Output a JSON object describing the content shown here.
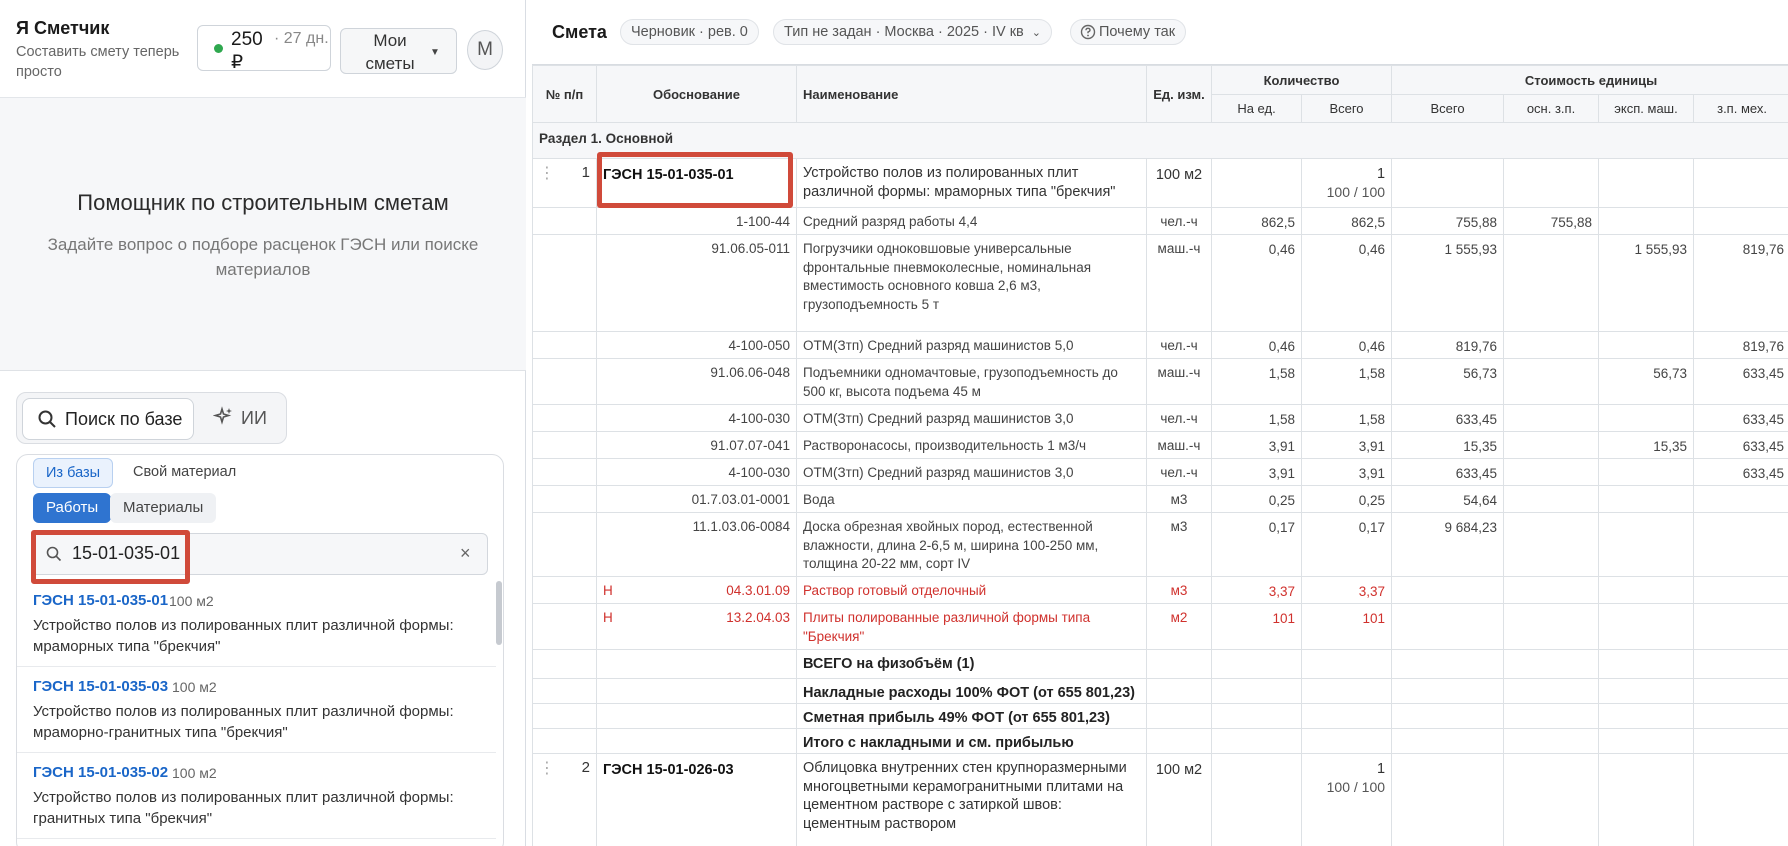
{
  "app": {
    "title": "Я Сметчик",
    "tagline": "Составить смету теперь просто",
    "balance_amount": "250 ₽",
    "balance_days": "· 27 дн.",
    "my_smety": "Мои сметы",
    "avatar": "М"
  },
  "helper": {
    "title": "Помощник по строительным сметам",
    "subtitle": "Задайте вопрос о подборе расценок ГЭСН или поиске материалов"
  },
  "modes": {
    "search": "Поиск по базе",
    "ai": "ИИ"
  },
  "results_panel": {
    "source_tabs": [
      "Из базы",
      "Свой материал"
    ],
    "kind_tabs": [
      "Работы",
      "Материалы"
    ],
    "search_value": "15-01-035-01",
    "clear": "×",
    "items": [
      {
        "code": "ГЭСН 15-01-035-01",
        "unit": "100 м2",
        "desc": "Устройство полов из полированных плит различной формы: мраморных типа \"брекчия\""
      },
      {
        "code": "ГЭСН 15-01-035-03",
        "unit": "100 м2",
        "desc": "Устройство полов из полированных плит различной формы: мраморно-гранитных типа \"брекчия\""
      },
      {
        "code": "ГЭСН 15-01-035-02",
        "unit": "100 м2",
        "desc": "Устройство полов из полированных плит различной формы: гранитных типа \"брекчия\""
      }
    ]
  },
  "estimate": {
    "title": "Смета",
    "status": "Черновик · рев. 0",
    "type": "Тип не задан · Москва · 2025 · IV кв",
    "why": "Почему так",
    "headers": {
      "num": "№ п/п",
      "basis": "Обоснование",
      "name": "Наименование",
      "unit": "Ед. изм.",
      "qty": "Количество",
      "qty_per": "На ед.",
      "qty_total": "Всего",
      "cost": "Стоимость единицы",
      "cost_total": "Всего",
      "cost_osn": "осн. з.п.",
      "cost_exp": "эксп. маш.",
      "cost_zpm": "з.п. мех."
    },
    "section": "Раздел 1. Основной",
    "pos1": {
      "num": "1",
      "code": "ГЭСН 15-01-035-01",
      "name": "Устройство полов из полированных плит различной формы: мраморных типа \"брекчия\"",
      "unit": "100 м2",
      "qty_total": "1",
      "qty_sub": "100 / 100"
    },
    "rows": [
      {
        "mark": "",
        "code": "1-100-44",
        "name": "Средний разряд работы 4,4",
        "unit": "чел.-ч",
        "per": "862,5",
        "tot": "862,5",
        "ctot": "755,88",
        "osn": "755,88",
        "exp": "",
        "zpm": ""
      },
      {
        "mark": "",
        "code": "91.06.05-011",
        "name": "Погрузчики одноковшовые универсальные фронтальные пневмоколесные, номинальная вместимость основного ковша 2,6 м3, грузоподъемность 5 т",
        "unit": "маш.-ч",
        "per": "0,46",
        "tot": "0,46",
        "ctot": "1 555,93",
        "osn": "",
        "exp": "1 555,93",
        "zpm": "819,76"
      },
      {
        "mark": "",
        "code": "4-100-050",
        "name": "ОТМ(Зтп) Средний разряд машинистов 5,0",
        "unit": "чел.-ч",
        "per": "0,46",
        "tot": "0,46",
        "ctot": "819,76",
        "osn": "",
        "exp": "",
        "zpm": "819,76"
      },
      {
        "mark": "",
        "code": "91.06.06-048",
        "name": "Подъемники одномачтовые, грузоподъемность до 500 кг, высота подъема 45 м",
        "unit": "маш.-ч",
        "per": "1,58",
        "tot": "1,58",
        "ctot": "56,73",
        "osn": "",
        "exp": "56,73",
        "zpm": "633,45"
      },
      {
        "mark": "",
        "code": "4-100-030",
        "name": "ОТМ(Зтп) Средний разряд машинистов 3,0",
        "unit": "чел.-ч",
        "per": "1,58",
        "tot": "1,58",
        "ctot": "633,45",
        "osn": "",
        "exp": "",
        "zpm": "633,45"
      },
      {
        "mark": "",
        "code": "91.07.07-041",
        "name": "Растворонасосы, производительность 1 м3/ч",
        "unit": "маш.-ч",
        "per": "3,91",
        "tot": "3,91",
        "ctot": "15,35",
        "osn": "",
        "exp": "15,35",
        "zpm": "633,45"
      },
      {
        "mark": "",
        "code": "4-100-030",
        "name": "ОТМ(Зтп) Средний разряд машинистов 3,0",
        "unit": "чел.-ч",
        "per": "3,91",
        "tot": "3,91",
        "ctot": "633,45",
        "osn": "",
        "exp": "",
        "zpm": "633,45"
      },
      {
        "mark": "",
        "code": "01.7.03.01-0001",
        "name": "Вода",
        "unit": "м3",
        "per": "0,25",
        "tot": "0,25",
        "ctot": "54,64",
        "osn": "",
        "exp": "",
        "zpm": ""
      },
      {
        "mark": "",
        "code": "11.1.03.06-0084",
        "name": "Доска обрезная хвойных пород, естественной влажности, длина 2-6,5 м, ширина 100-250 мм, толщина 20-22 мм, сорт IV",
        "unit": "м3",
        "per": "0,17",
        "tot": "0,17",
        "ctot": "9 684,23",
        "osn": "",
        "exp": "",
        "zpm": ""
      },
      {
        "mark": "Н",
        "code": "04.3.01.09",
        "name": "Раствор готовый отделочный",
        "unit": "м3",
        "per": "3,37",
        "tot": "3,37",
        "ctot": "",
        "osn": "",
        "exp": "",
        "zpm": ""
      },
      {
        "mark": "Н",
        "code": "13.2.04.03",
        "name": "Плиты полированные различной формы типа \"Брекчия\"",
        "unit": "м2",
        "per": "101",
        "tot": "101",
        "ctot": "",
        "osn": "",
        "exp": "",
        "zpm": ""
      }
    ],
    "totals": [
      "ВСЕГО на физобъём (1)",
      "Накладные расходы 100% ФОТ (от 655 801,23)",
      "Сметная прибыль 49% ФОТ (от 655 801,23)",
      "Итого с накладными и см. прибылью"
    ],
    "pos2": {
      "num": "2",
      "code": "ГЭСН 15-01-026-03",
      "name": "Облицовка внутренних стен крупноразмерными многоцветными керамогранитными плитами на цементном растворе с затиркой швов: цементным раствором",
      "unit": "100 м2",
      "qty_total": "1",
      "qty_sub": "100 / 100"
    }
  },
  "colors": {
    "accent": "#2f74d0",
    "link": "#1a66c8",
    "highlight": "#d04a3a",
    "new_material": "#d0312d",
    "ok": "#2fa84f"
  }
}
